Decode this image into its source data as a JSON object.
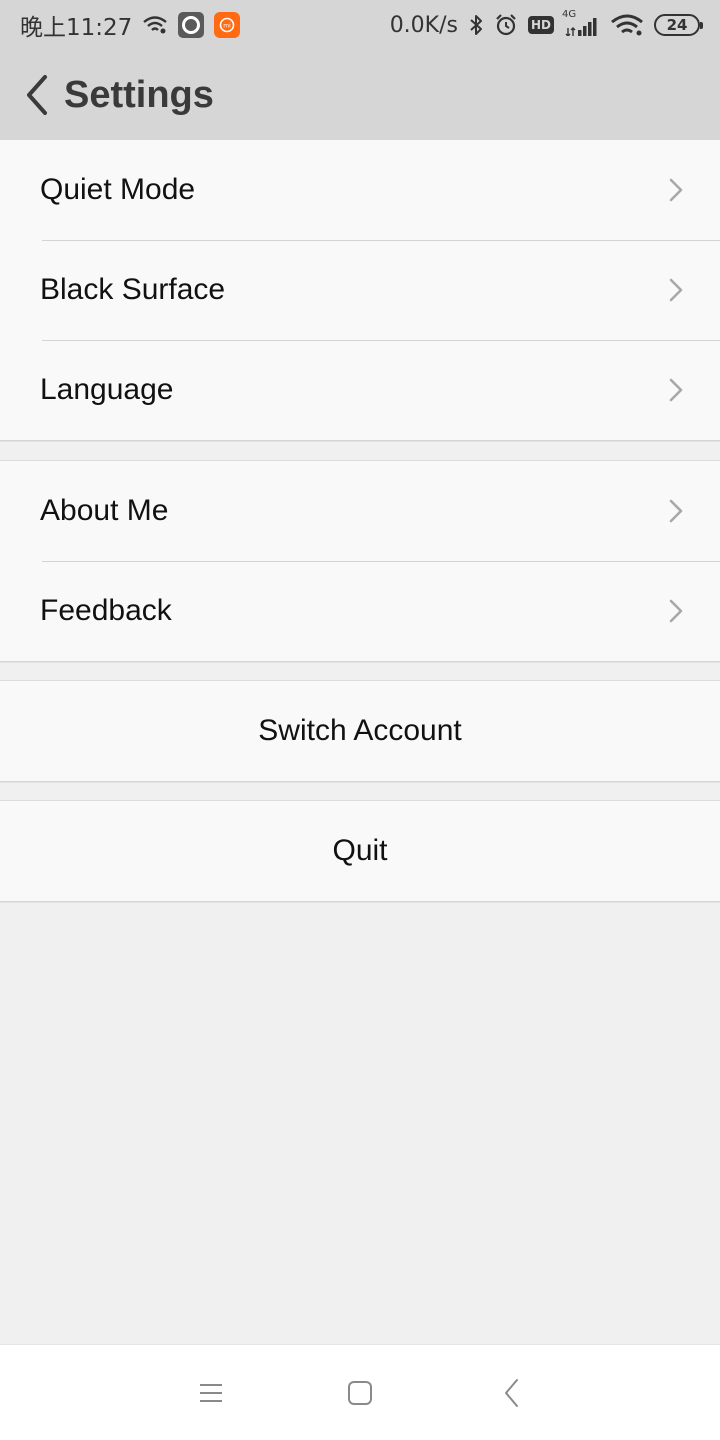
{
  "status_bar": {
    "time": "晚上11:27",
    "net_speed": "0.0K/s",
    "network_type": "4G",
    "hd_label": "HD",
    "battery_level": "24",
    "icons": [
      "wifi-small-icon",
      "app-gray-icon",
      "mi-app-icon",
      "bluetooth-icon",
      "alarm-icon",
      "hd-icon",
      "signal-icon",
      "wifi-icon",
      "battery-icon"
    ],
    "mi_app_text": "mi"
  },
  "header": {
    "title": "Settings",
    "back_icon": "chevron-left-icon"
  },
  "groups": {
    "display": {
      "items": [
        {
          "label": "Quiet Mode"
        },
        {
          "label": "Black Surface"
        },
        {
          "label": "Language"
        }
      ]
    },
    "info": {
      "items": [
        {
          "label": "About Me"
        },
        {
          "label": "Feedback"
        }
      ]
    },
    "account": {
      "label": "Switch Account"
    },
    "quit": {
      "label": "Quit"
    }
  },
  "nav_bar": {
    "items": [
      "menu-icon",
      "home-icon",
      "back-icon"
    ]
  },
  "colors": {
    "header_bg": "#d6d6d6",
    "page_bg": "#f0f0f0",
    "row_bg": "#f9f9f9",
    "chevron": "#a8a8a8",
    "mi_orange": "#ff6a13"
  }
}
